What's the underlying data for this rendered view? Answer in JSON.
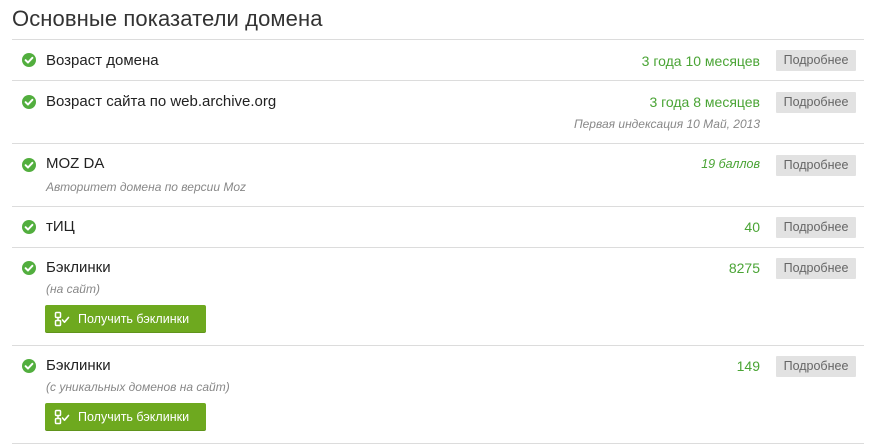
{
  "page": {
    "title": "Основные показатели домена"
  },
  "metrics": [
    {
      "label": "Возраст домена",
      "value": "3 года 10 месяцев",
      "button": "Подробнее"
    },
    {
      "label": "Возраст сайта по web.archive.org",
      "value": "3 года 8 месяцев",
      "note": "Первая индексация 10 Май, 2013",
      "button": "Подробнее"
    },
    {
      "label": "MOZ DA",
      "value": "19 баллов",
      "sub": "Авторитет домена по версии Moz",
      "button": "Подробнее"
    },
    {
      "label": "тИЦ",
      "value": "40",
      "button": "Подробнее"
    },
    {
      "label": "Бэклинки",
      "value": "8275",
      "sub": "(на сайт)",
      "button": "Подробнее",
      "action": "Получить бэклинки"
    },
    {
      "label": "Бэклинки",
      "value": "149",
      "sub": "(с уникальных доменов на сайт)",
      "button": "Подробнее",
      "action": "Получить бэклинки"
    }
  ],
  "colors": {
    "accent_green": "#4aa435",
    "check_green": "#52ae3e",
    "action_button": "#6ea91f",
    "more_button_bg": "#e2e2e2"
  },
  "icons": {
    "status": "check-circle-icon",
    "action": "link-check-icon"
  }
}
